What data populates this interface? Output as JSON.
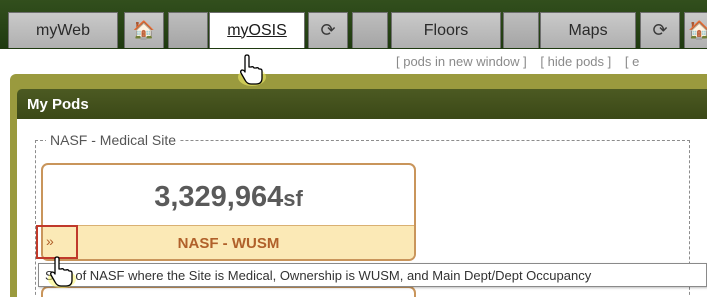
{
  "nav": {
    "tabs": [
      {
        "label": "myWeb"
      },
      {
        "icon": "home-icon",
        "glyph": "🏠"
      },
      {
        "label": "myOSIS",
        "active": true
      },
      {
        "icon": "refresh-icon",
        "glyph": "⟳"
      },
      {
        "label": "Floors"
      },
      {
        "label": "Maps"
      },
      {
        "icon": "refresh-icon",
        "glyph": "⟳"
      },
      {
        "icon": "home-icon",
        "glyph": "🏠"
      }
    ]
  },
  "subnav": {
    "links": [
      "[ pods in new window ]",
      "[ hide pods ]",
      "[ e"
    ]
  },
  "panel": {
    "title": "My Pods",
    "site_label": "NASF - Medical Site",
    "card": {
      "value": "3,329,964",
      "unit": "sf",
      "owner": "NASF - WUSM",
      "expand_glyph": "»"
    },
    "tooltip": "Sum of NASF where the Site is Medical, Ownership is WUSM, and Main Dept/Dept Occupancy"
  },
  "colors": {
    "nav_bg": "#2a4616",
    "panel_header": "#444f1b",
    "card_border": "#c9955b",
    "card_footer_bg": "#fbe9b6",
    "owner_text": "#b0602a",
    "highlight": "#c0392b"
  }
}
